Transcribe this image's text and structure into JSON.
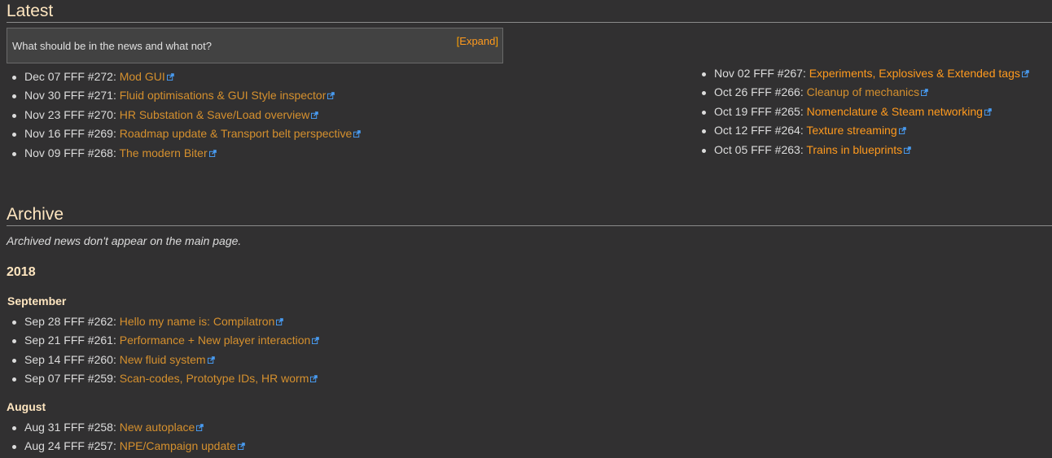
{
  "latest": {
    "heading": "Latest",
    "notice": {
      "text": "What should be in the news and what not?",
      "bracket_open": "[",
      "toggle_label": "Expand",
      "bracket_close": "]"
    },
    "left_items": [
      {
        "prefix": "Dec 07 FFF #272: ",
        "title": "Mod GUI"
      },
      {
        "prefix": "Nov 30 FFF #271: ",
        "title": "Fluid optimisations & GUI Style inspector"
      },
      {
        "prefix": "Nov 23 FFF #270: ",
        "title": "HR Substation & Save/Load overview"
      },
      {
        "prefix": "Nov 16 FFF #269: ",
        "title": "Roadmap update & Transport belt perspective"
      },
      {
        "prefix": "Nov 09 FFF #268: ",
        "title": "The modern Biter"
      }
    ],
    "right_items": [
      {
        "prefix": "Nov 02 FFF #267: ",
        "title": "Experiments, Explosives & Extended tags"
      },
      {
        "prefix": "Oct 26 FFF #266: ",
        "title": "Cleanup of mechanics"
      },
      {
        "prefix": "Oct 19 FFF #265: ",
        "title": "Nomenclature & Steam networking"
      },
      {
        "prefix": "Oct 12 FFF #264: ",
        "title": "Texture streaming"
      },
      {
        "prefix": "Oct 05 FFF #263: ",
        "title": "Trains in blueprints"
      }
    ]
  },
  "archive": {
    "heading": "Archive",
    "description": "Archived news don't appear on the main page.",
    "year": "2018",
    "september": {
      "label": "September",
      "items": [
        {
          "prefix": "Sep 28 FFF #262: ",
          "title": "Hello my name is: Compilatron"
        },
        {
          "prefix": "Sep 21 FFF #261: ",
          "title": "Performance + New player interaction"
        },
        {
          "prefix": "Sep 14 FFF #260: ",
          "title": "New fluid system"
        },
        {
          "prefix": "Sep 07 FFF #259: ",
          "title": "Scan-codes, Prototype IDs, HR worm"
        }
      ]
    },
    "august": {
      "label": "August",
      "items": [
        {
          "prefix": "Aug 31 FFF #258: ",
          "title": "New autoplace"
        },
        {
          "prefix": "Aug 24 FFF #257: ",
          "title": "NPE/Campaign update"
        }
      ]
    }
  },
  "colors": {
    "background": "#313031",
    "link": "#d5902e",
    "link_bright": "#ff9a1e",
    "heading": "#ffe6c0",
    "external_icon": "#4aa3ff"
  },
  "icons": {
    "external_link": "external-link-icon"
  }
}
